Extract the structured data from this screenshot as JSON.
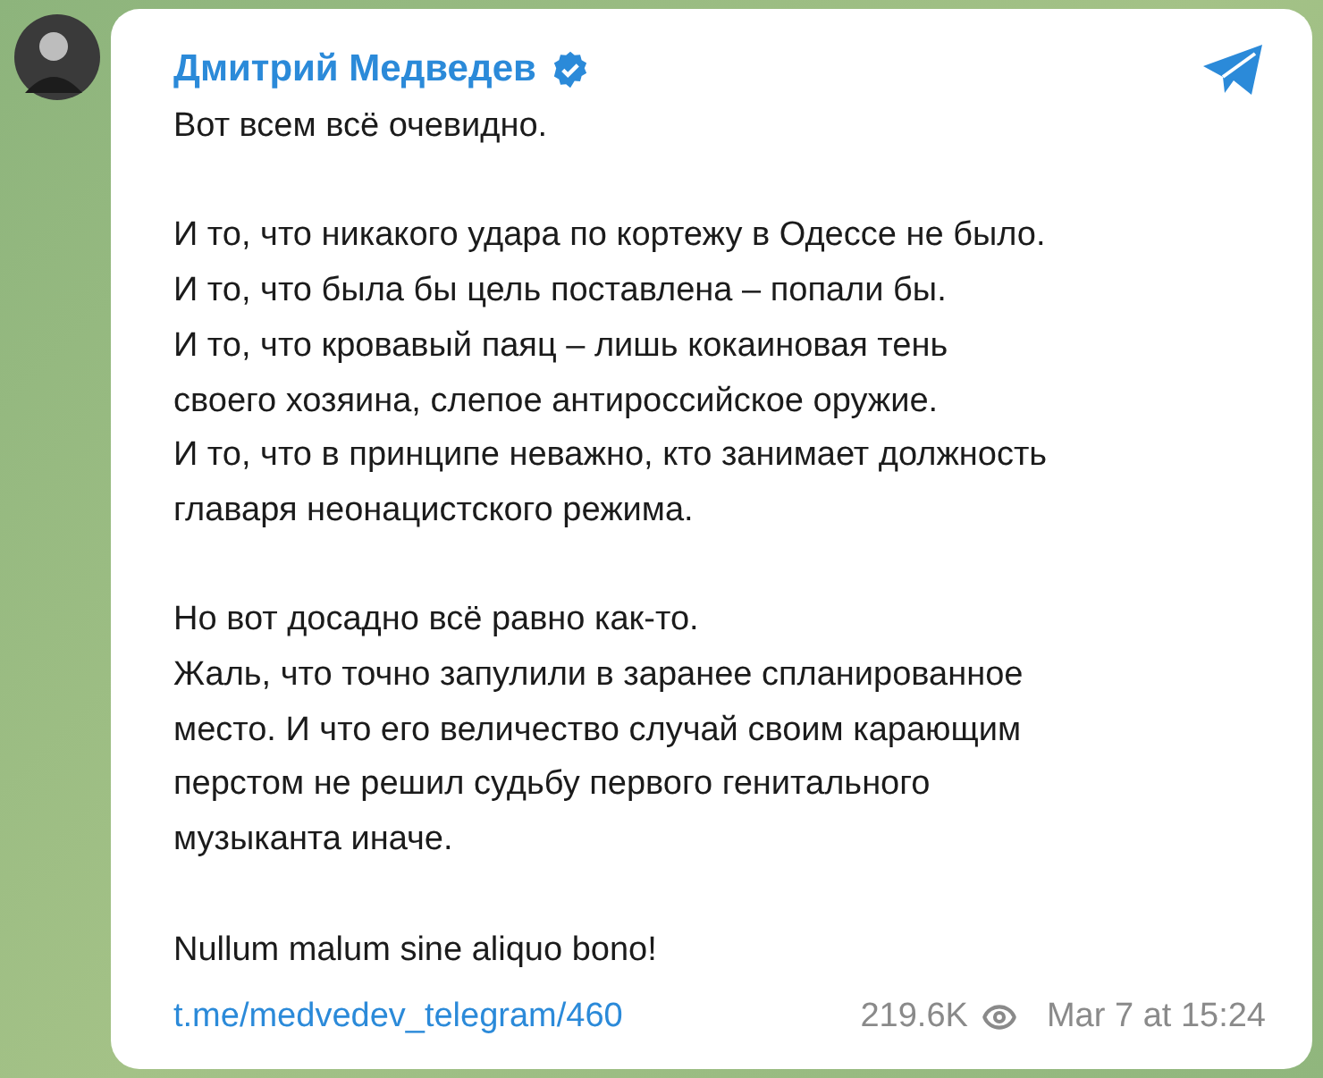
{
  "post": {
    "author": "Дмитрий Медведев",
    "paragraphs": [
      "Вот всем всё очевидно.",
      "И то, что никакого удара по кортежу в Одессе не было.\nИ то, что была бы цель поставлена – попали бы.\nИ то, что кровавый паяц – лишь кокаиновая тень\nсвоего хозяина, слепое антироссийское оружие.\nИ то, что в принципе неважно, кто занимает должность\nглаваря неонацистского режима.",
      "Но вот досадно всё равно как-то.\nЖаль, что точно запулили в заранее спланированное\nместо. И что его величество случай своим карающим\nперстом не решил судьбу первого генитального\nмузыканта иначе.",
      "Nullum malum sine aliquo bono!"
    ],
    "link": "t.me/medvedev_telegram/460",
    "views": "219.6K",
    "time": "Mar 7 at 15:24"
  }
}
